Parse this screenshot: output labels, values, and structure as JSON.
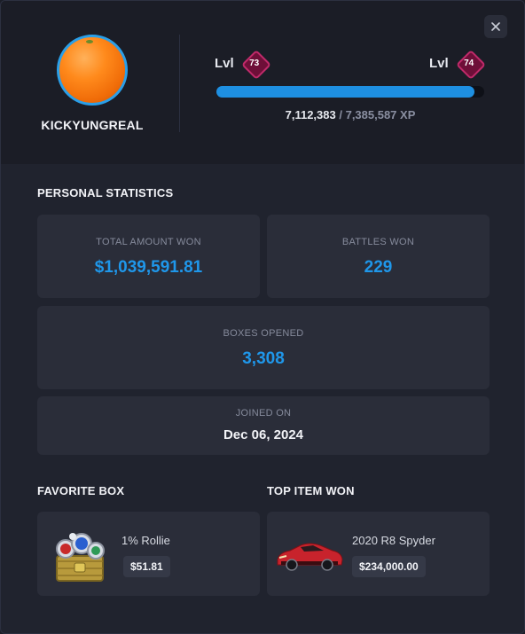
{
  "profile": {
    "username": "KICKYUNGREAL",
    "avatar_icon": "orange-avatar",
    "close_icon": "close-icon"
  },
  "level": {
    "label": "Lvl",
    "current": "73",
    "next": "74",
    "xp_current": "7,112,383",
    "xp_rest": "/ 7,385,587 XP",
    "progress_fraction": 0.963
  },
  "stats": {
    "section_title": "PERSONAL STATISTICS",
    "total_won_label": "TOTAL AMOUNT WON",
    "total_won_value": "$1,039,591.81",
    "battles_won_label": "BATTLES WON",
    "battles_won_value": "229",
    "boxes_opened_label": "BOXES OPENED",
    "boxes_opened_value": "3,308",
    "joined_label": "JOINED ON",
    "joined_value": "Dec 06, 2024"
  },
  "favorite_box": {
    "title": "FAVORITE BOX",
    "name": "1% Rollie",
    "price": "$51.81"
  },
  "top_item": {
    "title": "TOP ITEM WON",
    "name": "2020 R8 Spyder",
    "price": "$234,000.00"
  },
  "colors": {
    "accent": "#1f97ea",
    "panel": "#2a2d39",
    "background": "#20232e",
    "level_gem": "#c02a6a"
  }
}
